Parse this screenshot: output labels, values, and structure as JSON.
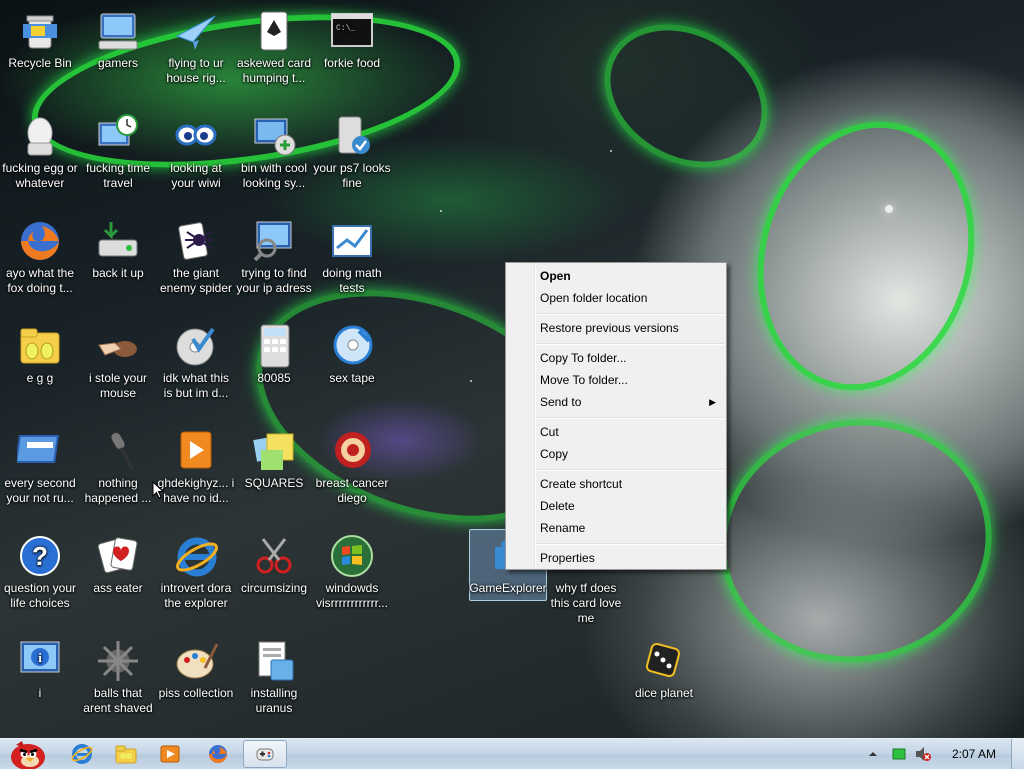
{
  "desktop_icons": [
    {
      "label": "Recycle Bin",
      "icon": "recycle-bin-icon"
    },
    {
      "label": "gamers",
      "icon": "computer-keyboard-icon"
    },
    {
      "label": "flying to ur house rig...",
      "icon": "paper-plane-icon"
    },
    {
      "label": "askewed card humping t...",
      "icon": "playing-card-icon"
    },
    {
      "label": "forkie food",
      "icon": "command-prompt-icon"
    },
    {
      "label": "fucking egg or whatever",
      "icon": "egg-device-icon"
    },
    {
      "label": "fucking time travel",
      "icon": "clock-monitor-icon"
    },
    {
      "label": "looking at your wiwi",
      "icon": "eyes-icon"
    },
    {
      "label": "bin with cool looking sy...",
      "icon": "network-monitor-icon"
    },
    {
      "label": "your ps7 looks fine",
      "icon": "device-check-icon"
    },
    {
      "label": "ayo what the fox doing t...",
      "icon": "firefox-icon"
    },
    {
      "label": "back it up",
      "icon": "backup-drive-icon"
    },
    {
      "label": "the giant enemy spider",
      "icon": "spider-solitaire-icon"
    },
    {
      "label": "trying to find your ip adress",
      "icon": "monitor-search-icon"
    },
    {
      "label": "doing math tests",
      "icon": "math-chart-icon"
    },
    {
      "label": "e g g",
      "icon": "folder-eggs-icon"
    },
    {
      "label": "i stole your mouse",
      "icon": "hand-mouse-icon"
    },
    {
      "label": "idk what this is but im d...",
      "icon": "disc-check-icon"
    },
    {
      "label": "80085",
      "icon": "calculator-icon"
    },
    {
      "label": "sex tape",
      "icon": "media-disc-icon"
    },
    {
      "label": "every second your not ru...",
      "icon": "presentation-icon"
    },
    {
      "label": "nothing happened ...",
      "icon": "microphone-icon"
    },
    {
      "label": "ghdekighyz... i have no id...",
      "icon": "media-player-icon"
    },
    {
      "label": "SQUARES",
      "icon": "sticky-notes-icon"
    },
    {
      "label": "breast cancer diego",
      "icon": "chess-titans-icon"
    },
    {
      "label": "question your life choices",
      "icon": "help-icon"
    },
    {
      "label": "ass eater",
      "icon": "card-hearts-icon"
    },
    {
      "label": "introvert dora the explorer",
      "icon": "internet-explorer-icon"
    },
    {
      "label": "circumsizing",
      "icon": "snipping-tool-icon"
    },
    {
      "label": "windowds visrrrrrrrrrrrr...",
      "icon": "windows-orb-icon"
    },
    {
      "label": "i",
      "icon": "info-monitor-icon"
    },
    {
      "label": "balls that arent shaved",
      "icon": "spiky-ball-icon"
    },
    {
      "label": "piss collection",
      "icon": "paint-palette-icon"
    },
    {
      "label": "installing uranus",
      "icon": "installer-icon"
    },
    {
      "label": "GameExplorer",
      "icon": "puzzle-piece-icon"
    },
    {
      "label": "why tf does this card love me",
      "icon": "card-icon"
    },
    {
      "label": "dice planet",
      "icon": "dice-icon"
    }
  ],
  "context_menu": {
    "items": [
      {
        "label": "Open",
        "bold": true
      },
      {
        "label": "Open folder location"
      },
      {
        "label": "Restore previous versions"
      },
      {
        "label": "Copy To folder..."
      },
      {
        "label": "Move To folder..."
      },
      {
        "label": "Send to",
        "submenu": true
      },
      {
        "label": "Cut"
      },
      {
        "label": "Copy"
      },
      {
        "label": "Create shortcut"
      },
      {
        "label": "Delete"
      },
      {
        "label": "Rename"
      },
      {
        "label": "Properties"
      }
    ]
  },
  "taskbar": {
    "start_icon": "angry-bird-icon",
    "pinned": [
      {
        "icon": "internet-explorer-icon"
      },
      {
        "icon": "windows-explorer-icon"
      },
      {
        "icon": "media-player-icon"
      },
      {
        "icon": "firefox-icon"
      },
      {
        "icon": "game-explorer-icon",
        "active": true
      }
    ],
    "tray_icons": [
      "show-hidden-icons-arrow-icon",
      "battery-icon",
      "volume-muted-icon"
    ],
    "clock": "2:07 AM"
  },
  "colors": {
    "accent_green": "#2fe04a",
    "menu_bg": "#f0f0f0",
    "taskbar_bg": "#c5d6e6"
  }
}
